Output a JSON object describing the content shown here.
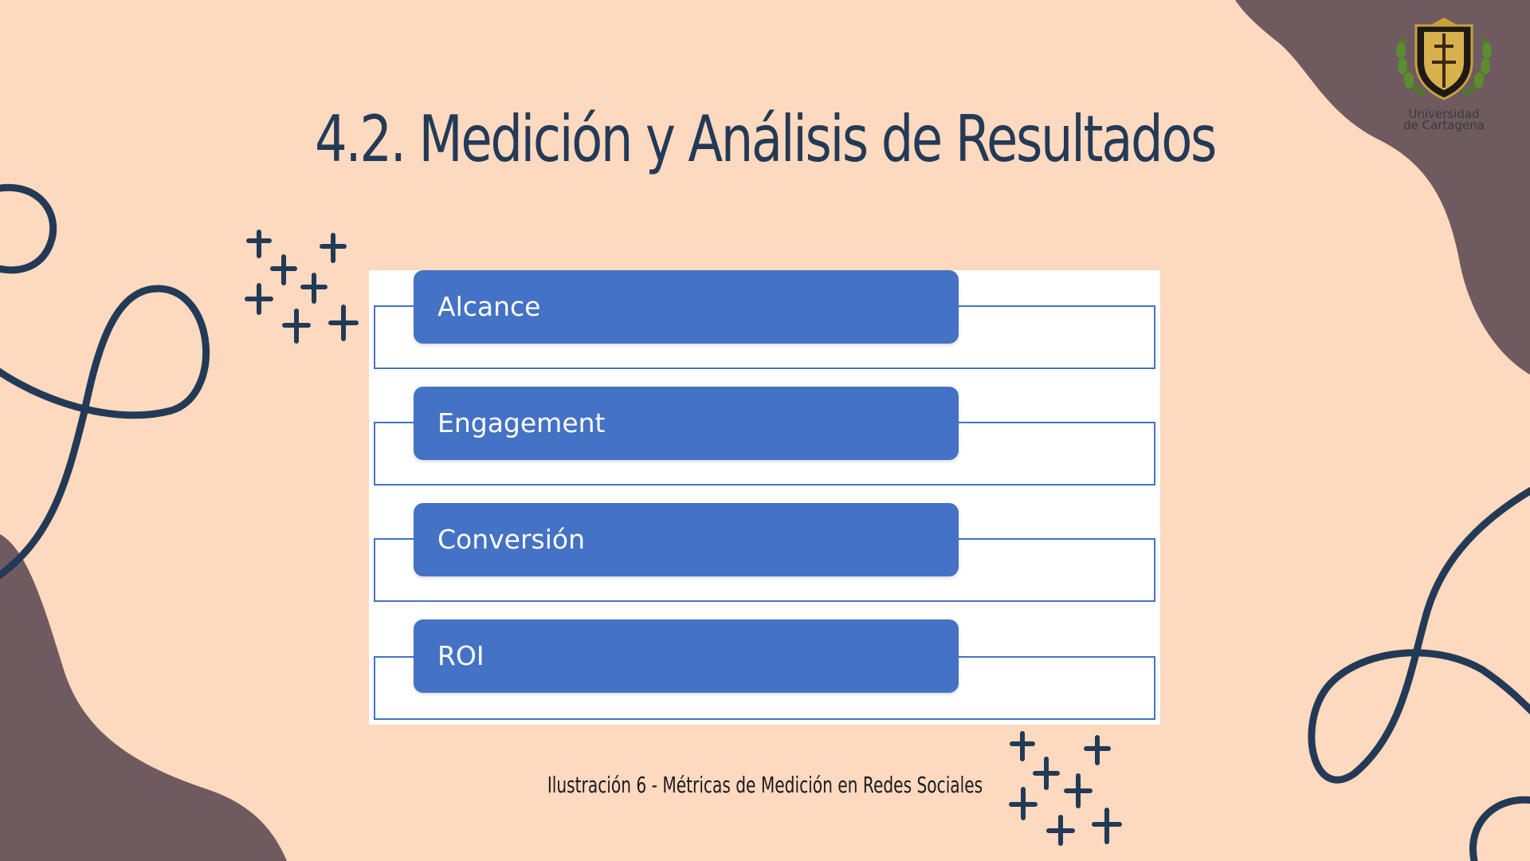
{
  "slide": {
    "title": "4.2. Medición y Análisis de Resultados",
    "caption": "Ilustración 6 - Métricas de Medición en Redes Sociales"
  },
  "diagram": {
    "items": [
      {
        "label": "Alcance"
      },
      {
        "label": "Engagement"
      },
      {
        "label": "Conversión"
      },
      {
        "label": "ROI"
      }
    ]
  },
  "logo": {
    "line1": "Universidad",
    "line2": "de Cartagena"
  },
  "colors": {
    "background": "#fdd9c0",
    "accent_dark": "#233a56",
    "blob": "#6f5b5f",
    "box_blue": "#4472c4",
    "white": "#ffffff"
  }
}
